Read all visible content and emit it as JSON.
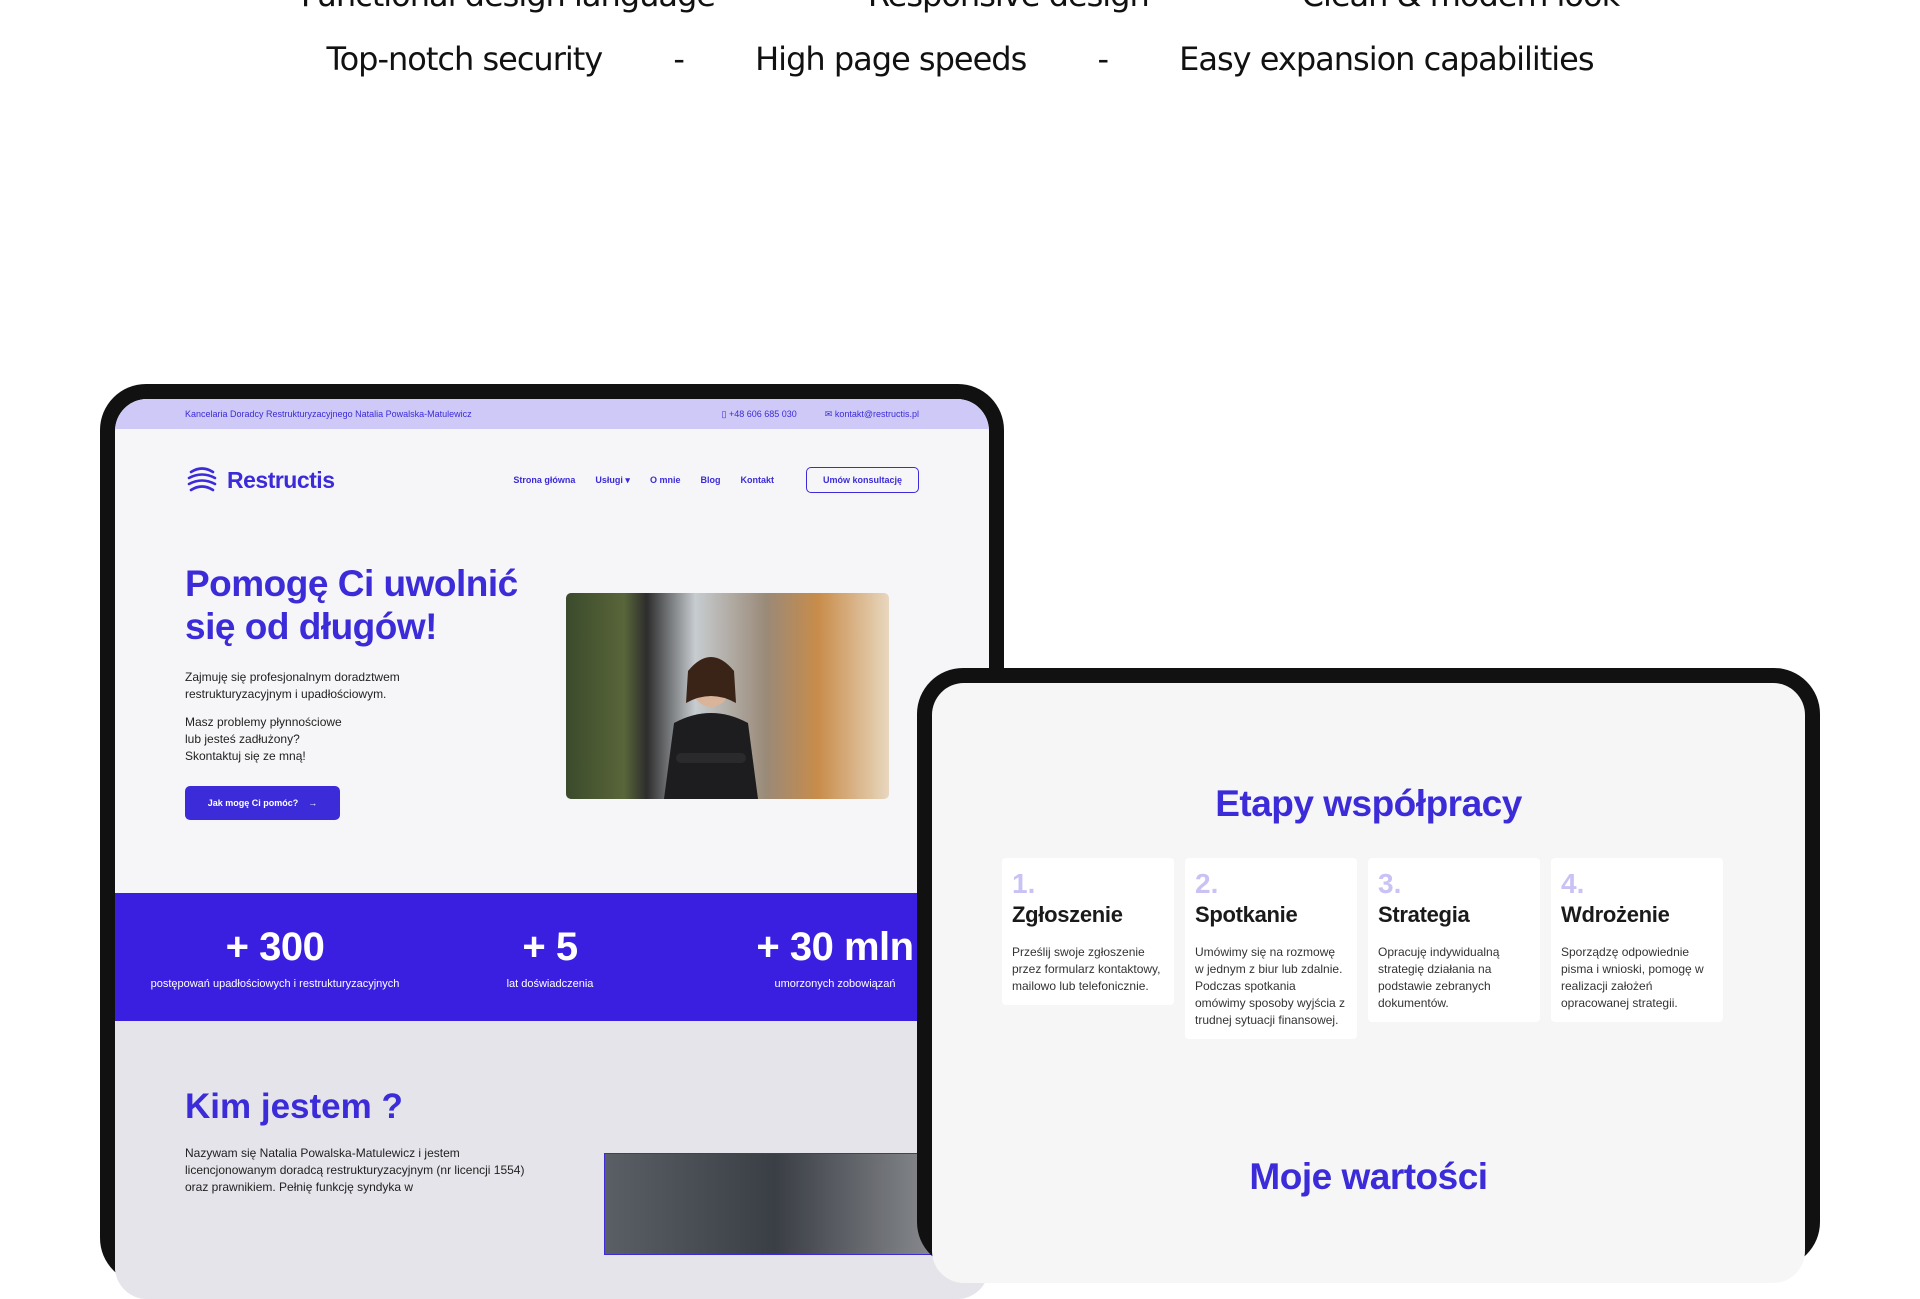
{
  "features": {
    "row1": [
      "Functional design language",
      "Responsive design",
      "Clean & modern look"
    ],
    "row2": [
      "Top-notch security",
      "High page speeds",
      "Easy expansion capabilities"
    ],
    "separator": "-"
  },
  "site1": {
    "topbar": {
      "company": "Kancelaria Doradcy Restrukturyzacyjnego Natalia Powalska-Matulewicz",
      "phone": "+48 606 685 030",
      "email": "kontakt@restructis.pl"
    },
    "logo": "Restructis",
    "nav": [
      "Strona główna",
      "Usługi",
      "O mnie",
      "Blog",
      "Kontakt"
    ],
    "cta": "Umów konsultację",
    "hero": {
      "title": "Pomogę Ci uwolnić się od długów!",
      "p1": "Zajmuję się profesjonalnym doradztwem restrukturyzacyjnym i upadłościowym.",
      "p2_lines": [
        "Masz problemy płynnościowe",
        "lub jesteś zadłużony?",
        "Skontaktuj się ze mną!"
      ],
      "button": "Jak mogę Ci pomóc?"
    },
    "stats": [
      {
        "value": "+ 300",
        "label": "postępowań upadłościowych i restrukturyzacyjnych"
      },
      {
        "value": "+ 5",
        "label": "lat doświadczenia"
      },
      {
        "value": "+ 30 mln",
        "label": "umorzonych zobowiązań"
      }
    ],
    "about": {
      "title": "Kim jestem ?",
      "text": "Nazywam się Natalia Powalska-Matulewicz i jestem licencjonowanym doradcą restrukturyzacyjnym (nr licencji 1554) oraz prawnikiem. Pełnię funkcję syndyka w"
    }
  },
  "site2": {
    "title": "Etapy współpracy",
    "steps": [
      {
        "num": "1.",
        "heading": "Zgłoszenie",
        "text": "Prześlij swoje zgłoszenie przez formularz kontaktowy, mailowo lub telefonicznie."
      },
      {
        "num": "2.",
        "heading": "Spotkanie",
        "text": "Umówimy się na rozmowę w jednym z biur lub zdalnie. Podczas spotkania omówimy sposoby wyjścia z trudnej sytuacji finansowej."
      },
      {
        "num": "3.",
        "heading": "Strategia",
        "text": "Opracuję indywidualną strategię działania na podstawie zebranych dokumentów."
      },
      {
        "num": "4.",
        "heading": "Wdrożenie",
        "text": "Sporządzę odpowiednie pisma i wnioski, pomogę w realizacji założeń opracowanej strategii."
      }
    ],
    "values_title": "Moje wartości"
  },
  "colors": {
    "brand": "#3b2bd8",
    "stats_bg": "#3b1fe0",
    "topbar_bg": "#cfc9f7"
  }
}
